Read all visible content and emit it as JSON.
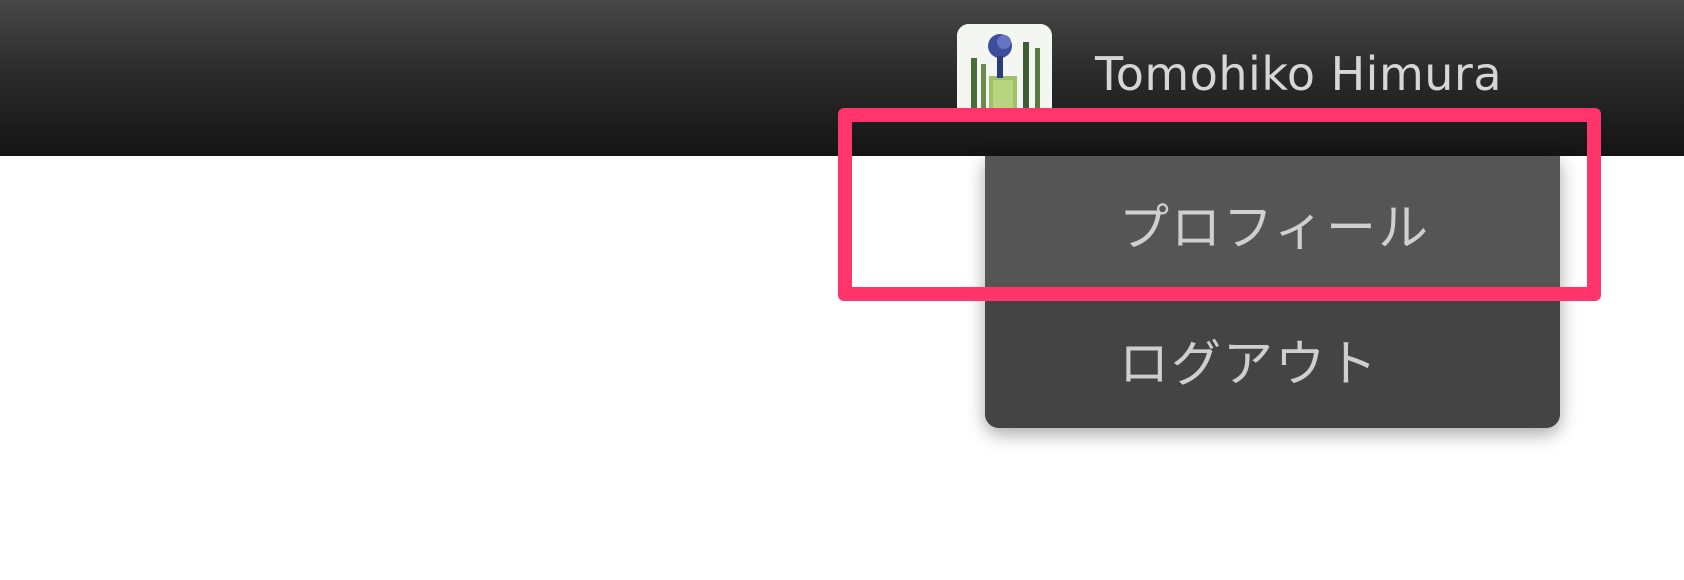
{
  "header": {
    "user_name": "Tomohiko Himura",
    "avatar_icon": "user-avatar-image"
  },
  "user_menu": {
    "items": [
      {
        "label": "プロフィール",
        "icon": ""
      },
      {
        "label": "ログアウト",
        "icon": ""
      }
    ]
  },
  "annotation": {
    "highlight_color": "#ff356b",
    "highlighted_item": "プロフィール"
  }
}
